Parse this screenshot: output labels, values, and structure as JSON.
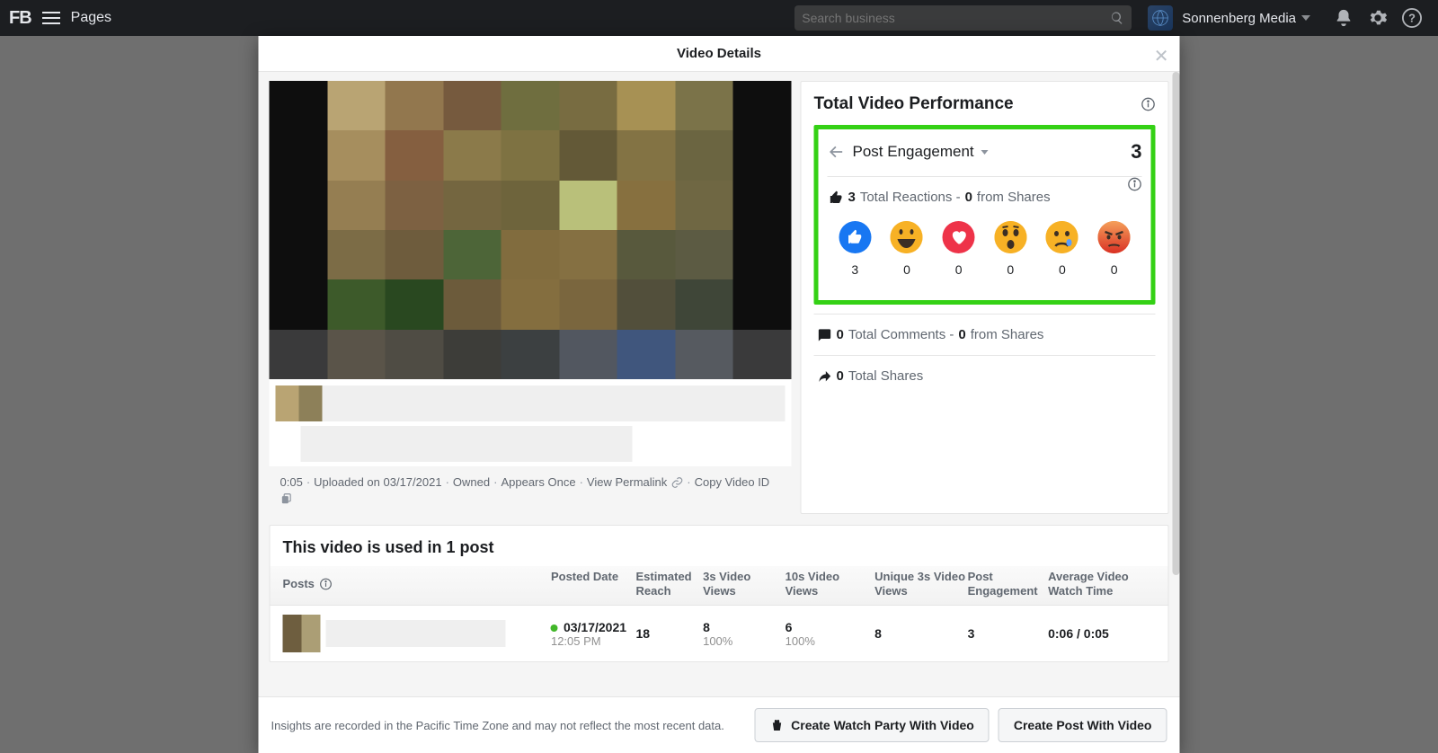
{
  "topbar": {
    "logo": "FB",
    "nav_label": "Pages",
    "search_placeholder": "Search business",
    "account_name": "Sonnenberg Media"
  },
  "modal": {
    "title": "Video Details",
    "meta": {
      "duration": "0:05",
      "uploaded": "Uploaded on 03/17/2021",
      "owned": "Owned",
      "appears": "Appears Once",
      "permalink": "View Permalink",
      "copy_id": "Copy Video ID"
    },
    "perf": {
      "title": "Total Video Performance",
      "pe_label": "Post Engagement",
      "pe_value": "3",
      "reactions_total": "3",
      "reactions_label": "Total Reactions -",
      "reactions_shares": "0",
      "reactions_shares_label": "from Shares",
      "reactions": [
        {
          "name": "like",
          "count": "3"
        },
        {
          "name": "haha",
          "count": "0"
        },
        {
          "name": "love",
          "count": "0"
        },
        {
          "name": "wow",
          "count": "0"
        },
        {
          "name": "sad",
          "count": "0"
        },
        {
          "name": "angry",
          "count": "0"
        }
      ],
      "comments_total": "0",
      "comments_label": "Total Comments -",
      "comments_shares": "0",
      "comments_shares_label": "from Shares",
      "shares_total": "0",
      "shares_label": "Total Shares"
    },
    "usage": {
      "title": "This video is used in 1 post",
      "columns": {
        "posts": "Posts",
        "date": "Posted Date",
        "reach": "Estimated Reach",
        "v3s": "3s Video Views",
        "v10s": "10s Video Views",
        "u3s": "Unique 3s Video Views",
        "pe": "Post Engagement",
        "wt": "Average Video Watch Time"
      },
      "row": {
        "date": "03/17/2021",
        "time": "12:05 PM",
        "reach": "18",
        "v3s": "8",
        "v3s_pct": "100%",
        "v10s": "6",
        "v10s_pct": "100%",
        "u3s": "8",
        "pe": "3",
        "wt": "0:06 / 0:05"
      }
    },
    "footer": {
      "note": "Insights are recorded in the Pacific Time Zone and may not reflect the most recent data.",
      "btn_watch": "Create Watch Party With Video",
      "btn_post": "Create Post With Video"
    }
  },
  "thumb_colors": [
    "#0e0e0e",
    "#b9a473",
    "#92774e",
    "#765a3e",
    "#6f6e3f",
    "#786c41",
    "#a79154",
    "#7b7349",
    "#0e0e0e",
    "#0e0e0e",
    "#a68e5e",
    "#855f40",
    "#8b7a4a",
    "#7e7242",
    "#635937",
    "#837344",
    "#6b6541",
    "#0e0e0e",
    "#0e0e0e",
    "#957e52",
    "#7d6142",
    "#746640",
    "#6e643c",
    "#b9c07a",
    "#87703f",
    "#6f6743",
    "#0e0e0e",
    "#0e0e0e",
    "#7c6c46",
    "#6e5c3d",
    "#4d6538",
    "#816c3e",
    "#857042",
    "#58593d",
    "#5c5b43",
    "#0e0e0e",
    "#0e0e0e",
    "#3d5a2a",
    "#294820",
    "#6c5b3b",
    "#846e3f",
    "#7a663e",
    "#524f3b",
    "#3f4638",
    "#0e0e0e",
    "#3a3a3b",
    "#5a5449",
    "#4f4c44",
    "#3d3d39",
    "#3c4041",
    "#525760",
    "#40567d",
    "#565a60",
    "#3a3a3b"
  ]
}
